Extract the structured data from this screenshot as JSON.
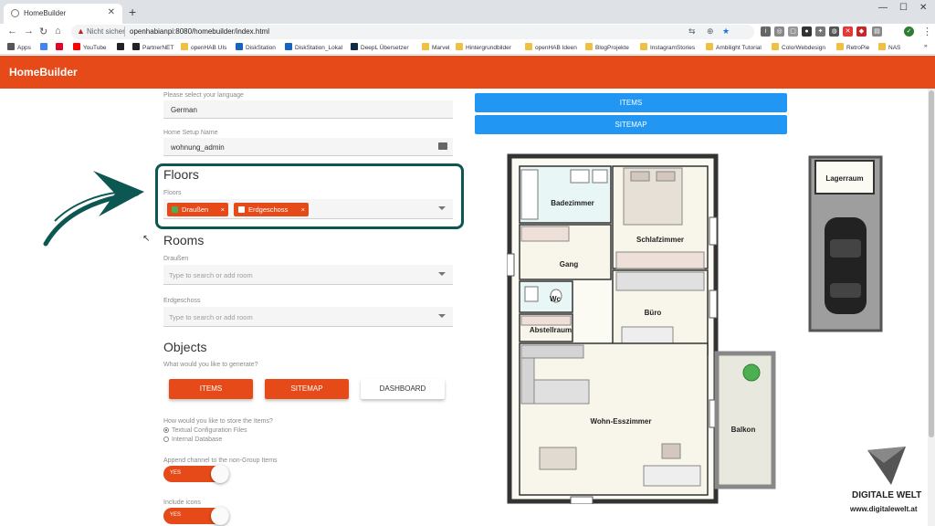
{
  "browser": {
    "tab_title": "HomeBuilder",
    "url_warning": "Nicht sicher",
    "url": "openhabianpi:8080/homebuilder/index.html",
    "bookmarks": [
      {
        "label": "Apps",
        "color": "#555"
      },
      {
        "label": "",
        "color": "#4285f4"
      },
      {
        "label": "",
        "color": "#e60023"
      },
      {
        "label": "YouTube",
        "color": "#ff0000"
      },
      {
        "label": "",
        "color": "#222"
      },
      {
        "label": "PartnerNET",
        "color": "#222"
      },
      {
        "label": "openHAB UIs",
        "color": "#f0c040"
      },
      {
        "label": "DiskStation",
        "color": "#1565c0"
      },
      {
        "label": "DiskStation_Lokal",
        "color": "#1565c0"
      },
      {
        "label": "DeepL Übersetzer",
        "color": "#0f2b46"
      },
      {
        "label": "Marvel",
        "color": "#f0c040"
      },
      {
        "label": "Hintergrundbilder",
        "color": "#f0c040"
      },
      {
        "label": "openHAB Ideen",
        "color": "#f0c040"
      },
      {
        "label": "BlogProjekte",
        "color": "#f0c040"
      },
      {
        "label": "InstagramStories",
        "color": "#f0c040"
      },
      {
        "label": "Ambilight Tutorial",
        "color": "#f0c040"
      },
      {
        "label": "ColorWebdesign",
        "color": "#f0c040"
      },
      {
        "label": "RetroPie",
        "color": "#f0c040"
      },
      {
        "label": "NAS",
        "color": "#f0c040"
      }
    ]
  },
  "app": {
    "title": "HomeBuilder",
    "accent": "#e64a19",
    "language": {
      "label": "Please select your language",
      "value": "German"
    },
    "setup_name": {
      "label": "Home Setup Name",
      "value": "wohnung_admin"
    },
    "floors": {
      "heading": "Floors",
      "label": "Floors",
      "chips": [
        {
          "label": "Draußen",
          "icon": "garden-icon",
          "icon_color": "#4caf50"
        },
        {
          "label": "Erdgeschoss",
          "icon": "house-icon",
          "icon_color": "#ffffff"
        }
      ]
    },
    "rooms": {
      "heading": "Rooms",
      "groups": [
        {
          "label": "Draußen",
          "placeholder": "Type to search or add room"
        },
        {
          "label": "Erdgeschoss",
          "placeholder": "Type to search or add room"
        }
      ]
    },
    "objects": {
      "heading": "Objects",
      "question": "What would you like to generate?",
      "buttons": [
        "ITEMS",
        "SITEMAP",
        "DASHBOARD"
      ]
    },
    "store": {
      "question": "How would you like to store the Items?",
      "options": [
        "Textual Configuration Files",
        "Internal Database"
      ],
      "selected": 0
    },
    "append_channel": {
      "label": "Append channel to the non-Group Items",
      "toggle": "YES"
    },
    "include_icons": {
      "label": "Include icons",
      "toggle": "YES"
    },
    "preview_buttons": [
      "ITEMS",
      "SITEMAP"
    ]
  },
  "floorplan": {
    "rooms": [
      "Badezimmer",
      "Schlafzimmer",
      "Gang",
      "Wc",
      "Büro",
      "Abstellraum",
      "Wohn-Esszimmer",
      "Balkon",
      "Lagerraum"
    ]
  },
  "logo": {
    "name": "DIGITALE WELT",
    "url": "www.digitalewelt.at"
  }
}
